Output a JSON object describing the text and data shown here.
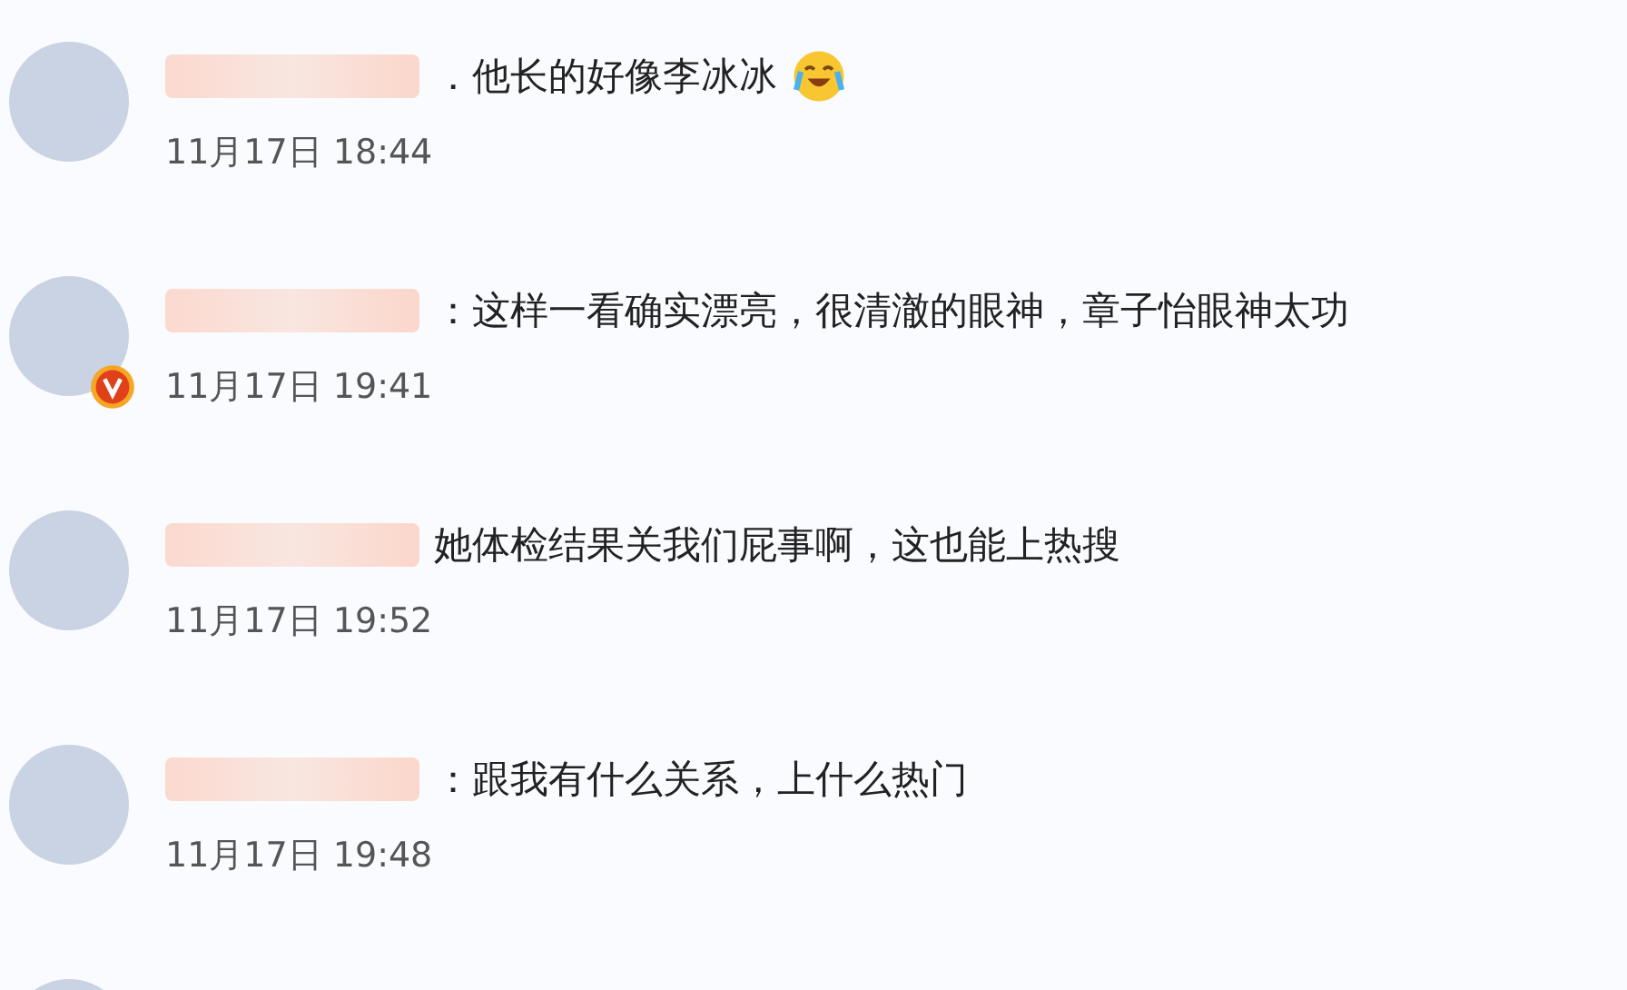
{
  "comments": [
    {
      "text": "．他长的好像李冰冰",
      "time": "11月17日 18:44",
      "verified": false,
      "emoji": true
    },
    {
      "text": "：这样一看确实漂亮，很清澈的眼神，章子怡眼神太功",
      "time": "11月17日 19:41",
      "verified": true,
      "emoji": false
    },
    {
      "text": "她体检结果关我们屁事啊，这也能上热搜",
      "time": "11月17日 19:52",
      "verified": false,
      "emoji": false
    },
    {
      "text": "：跟我有什么关系，上什么热门",
      "time": "11月17日 19:48",
      "verified": false,
      "emoji": false
    }
  ]
}
